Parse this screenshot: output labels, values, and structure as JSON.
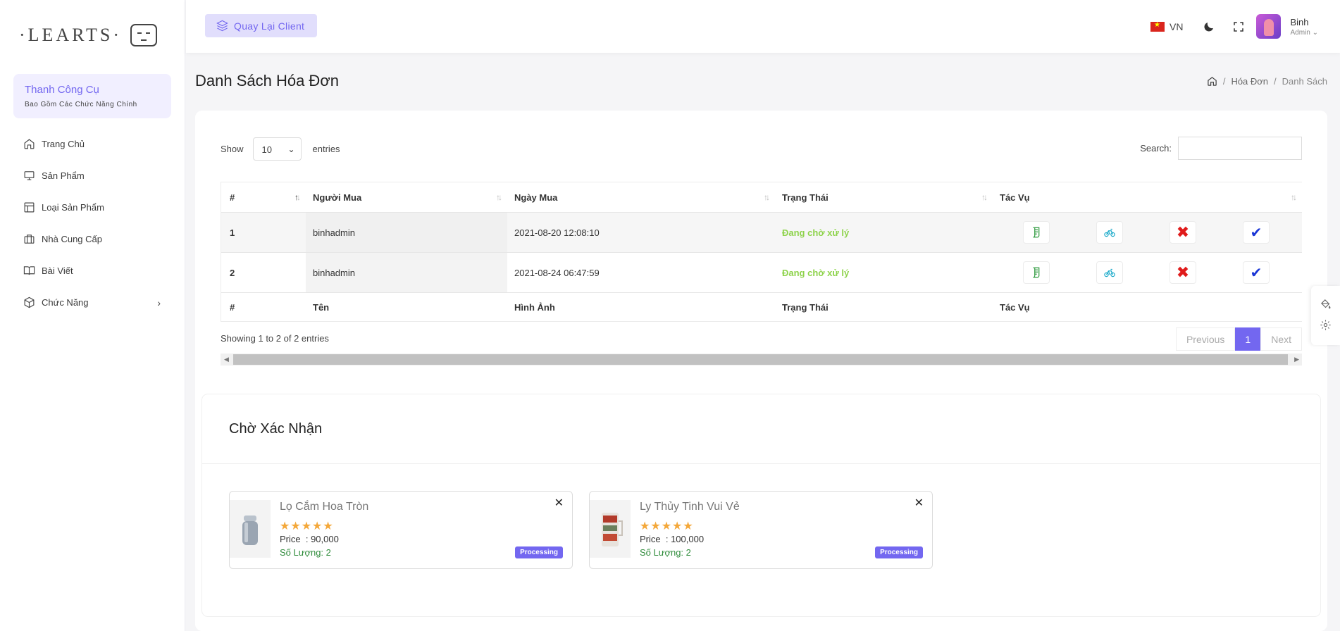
{
  "brand": {
    "logo_text": "·LEARTS·"
  },
  "sidebar": {
    "toolbox_title": "Thanh Công Cụ",
    "toolbox_sub": "Bao Gồm Các Chức Năng Chính",
    "items": [
      {
        "label": "Trang Chủ",
        "icon": "home-icon"
      },
      {
        "label": "Sản Phẩm",
        "icon": "monitor-icon"
      },
      {
        "label": "Loại Sản Phẩm",
        "icon": "layout-icon"
      },
      {
        "label": "Nhà Cung Cấp",
        "icon": "briefcase-icon"
      },
      {
        "label": "Bài Viết",
        "icon": "book-icon"
      },
      {
        "label": "Chức Năng",
        "icon": "package-icon",
        "chevron": "›"
      }
    ]
  },
  "header": {
    "back_label": "Quay Lại Client",
    "lang": "VN",
    "user_name": "Binh",
    "user_role": "Admin ⌄"
  },
  "page": {
    "title": "Danh Sách Hóa Đơn",
    "breadcrumb": [
      "Hóa Đơn",
      "Danh Sách"
    ]
  },
  "table": {
    "show_label": "Show",
    "entries_value": "10",
    "entries_label": "entries",
    "search_label": "Search:",
    "headers": [
      "#",
      "Người Mua",
      "Ngày Mua",
      "Trạng Thái",
      "Tác Vụ"
    ],
    "rows": [
      {
        "id": "1",
        "buyer": "binhadmin",
        "date": "2021-08-20 12:08:10",
        "status": "Đang chờ xử lý"
      },
      {
        "id": "2",
        "buyer": "binhadmin",
        "date": "2021-08-24 06:47:59",
        "status": "Đang chờ xử lý"
      }
    ],
    "footers": [
      "#",
      "Tên",
      "Hình Ảnh",
      "Trạng Thái",
      "Tác Vụ"
    ],
    "info": "Showing 1 to 2 of 2 entries",
    "pager": {
      "previous": "Previous",
      "current": "1",
      "next": "Next"
    },
    "status_color": "#8ed34b"
  },
  "pending": {
    "title": "Chờ Xác Nhận",
    "items": [
      {
        "name": "Lọ Cắm Hoa Tròn",
        "stars": "★★★★★",
        "price_label": "Price",
        "price": "90,000",
        "qty_label": "Số Lượng:",
        "qty": "2",
        "badge": "Processing"
      },
      {
        "name": "Ly Thủy Tinh Vui Vẻ",
        "stars": "★★★★★",
        "price_label": "Price",
        "price": "100,000",
        "qty_label": "Số Lượng:",
        "qty": "2",
        "badge": "Processing"
      }
    ]
  },
  "colors": {
    "accent": "#7367f0",
    "accent_light": "#e1defc"
  }
}
